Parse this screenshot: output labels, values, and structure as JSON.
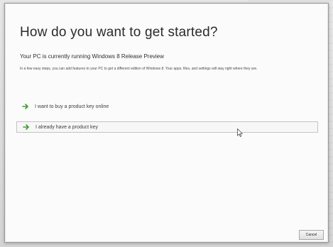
{
  "dialog": {
    "title": "How do you want to get started?",
    "subtitle": "Your PC is currently running Windows 8 Release Preview",
    "description": "In a few easy steps, you can add features to your PC to get a different edition of Windows 8. Your apps, files, and settings will stay right where they are.",
    "options": [
      {
        "label": "I want to buy a product key online",
        "icon": "green-arrow-icon"
      },
      {
        "label": "I already have a product key",
        "icon": "green-arrow-icon"
      }
    ],
    "cancel_label": "Cancel"
  },
  "colors": {
    "accent_green": "#3c9d2f",
    "title_text": "#2b2b2b",
    "dialog_bg": "#fbfbfb"
  }
}
